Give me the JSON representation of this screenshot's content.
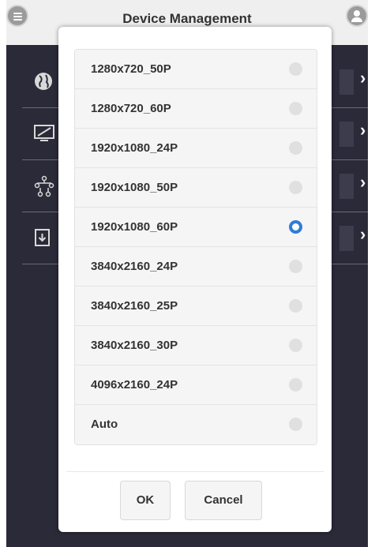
{
  "topbar": {
    "title": "Device Management"
  },
  "background_rows": [
    {
      "icon": "globe-icon"
    },
    {
      "icon": "monitor-icon"
    },
    {
      "icon": "network-icon"
    },
    {
      "icon": "download-icon"
    }
  ],
  "dialog": {
    "options": [
      {
        "label": "1280x720_50P",
        "selected": false
      },
      {
        "label": "1280x720_60P",
        "selected": false
      },
      {
        "label": "1920x1080_24P",
        "selected": false
      },
      {
        "label": "1920x1080_50P",
        "selected": false
      },
      {
        "label": "1920x1080_60P",
        "selected": true
      },
      {
        "label": "3840x2160_24P",
        "selected": false
      },
      {
        "label": "3840x2160_25P",
        "selected": false
      },
      {
        "label": "3840x2160_30P",
        "selected": false
      },
      {
        "label": "4096x2160_24P",
        "selected": false
      },
      {
        "label": "Auto",
        "selected": false
      }
    ],
    "ok_label": "OK",
    "cancel_label": "Cancel"
  },
  "colors": {
    "accent": "#2f7dd6",
    "background": "#2b2a38"
  }
}
